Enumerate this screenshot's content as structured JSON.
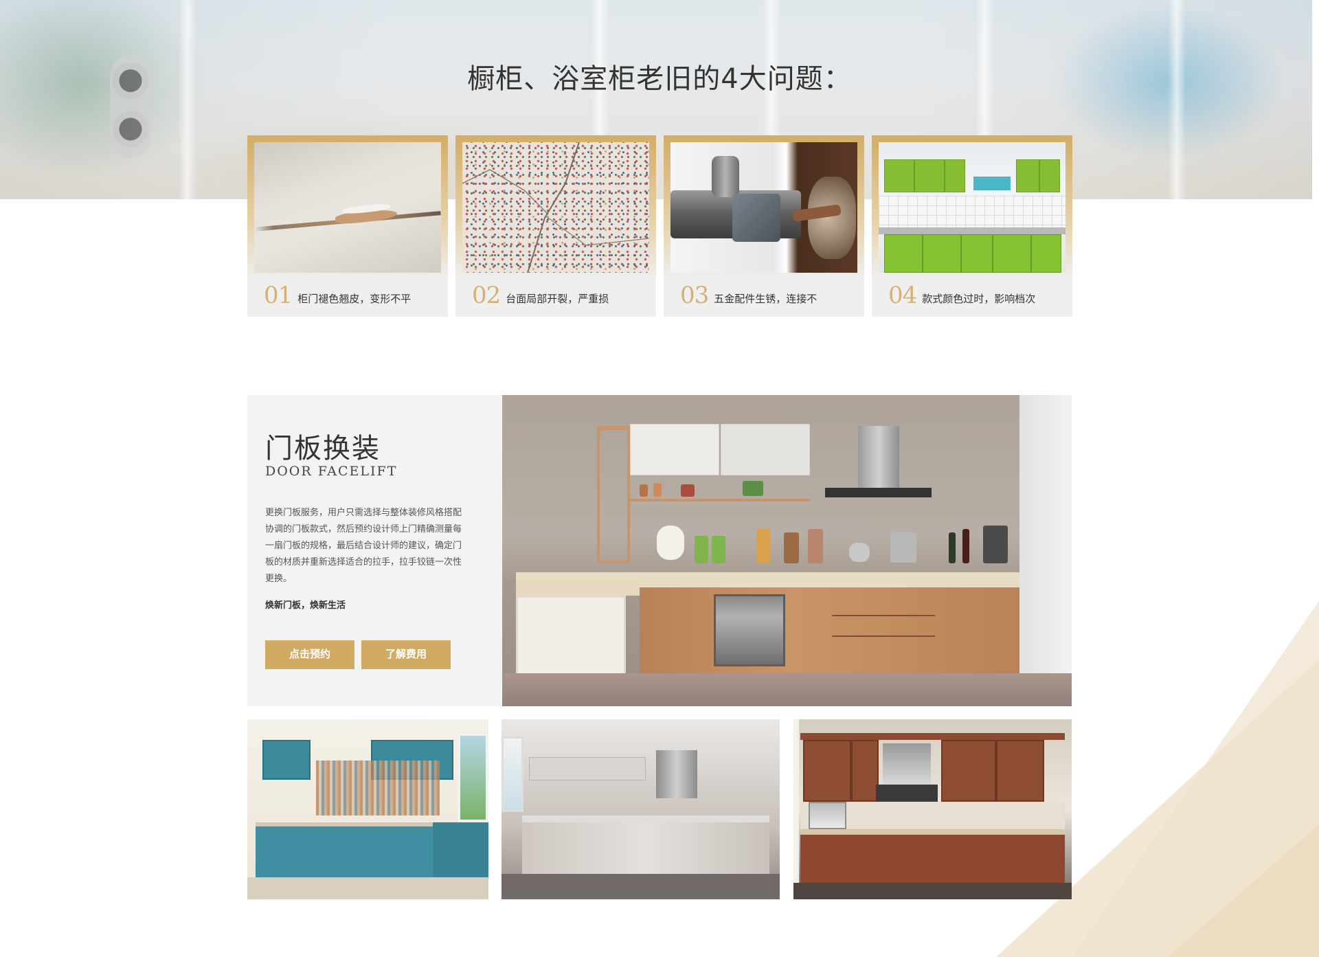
{
  "hero": {
    "title": "橱柜、浴室柜老旧的4大问题："
  },
  "problems": [
    {
      "num": "01",
      "text": "柜门褪色翘皮，变形不平"
    },
    {
      "num": "02",
      "text": "台面局部开裂，严重损"
    },
    {
      "num": "03",
      "text": "五金配件生锈，连接不"
    },
    {
      "num": "04",
      "text": "款式颜色过时，影响档次"
    }
  ],
  "facelift": {
    "title": "门板换装",
    "subtitle": "DOOR FACELIFT",
    "description": "更换门板服务，用户只需选择与整体装修风格搭配协调的门板款式，然后预约设计师上门精确测量每一扇门板的规格，最后结合设计师的建议，确定门板的材质并重新选择适合的拉手，拉手铰链一次性更换。",
    "slogan": "焕新门板，焕新生活",
    "book_label": "点击预约",
    "cost_label": "了解费用"
  },
  "colors": {
    "accent_gold": "#d1ab64",
    "number_gold": "#d5b074",
    "panel_bg": "#f3f3f1",
    "card_bg": "#efefef",
    "deco_beige": "#efe3cd"
  },
  "icons": {
    "book_button": "none",
    "cost_button": "none"
  }
}
